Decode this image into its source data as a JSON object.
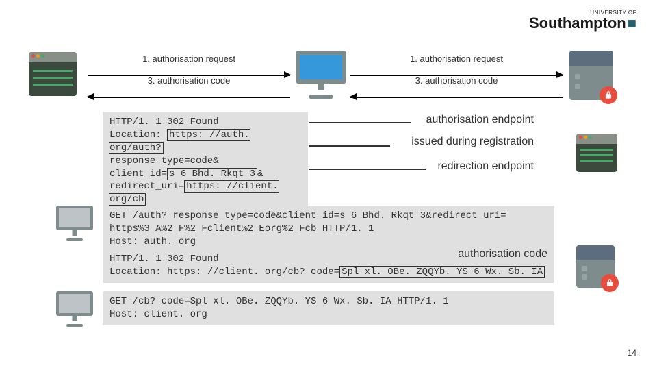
{
  "logo": {
    "top": "UNIVERSITY OF",
    "main": "Southampton"
  },
  "arrows": {
    "step1_left": "1. authorisation request",
    "step1_right": "1. authorisation request",
    "step3_left": "3. authorisation code",
    "step3_right": "3. authorisation code"
  },
  "http": {
    "box1": {
      "line1_pre": "HTTP/1. 1 ",
      "line1_hl": "302 Found",
      "line2_pre": "Location: ",
      "line2_hl": "https: //auth. org/auth?",
      "line3": "  response_type=code&",
      "line4_pre": "  client_id=",
      "line4_hl": "s 6 Bhd. Rkqt 3",
      "line4_post": "&",
      "line5_pre": "  redirect_uri=",
      "line5_hl": "https: //client. org/cb"
    },
    "box2": {
      "line1": "GET /auth? response_type=code&client_id=s 6 Bhd. Rkqt 3&redirect_uri=",
      "line2": "    https%3 A%2 F%2 Fclient%2 Eorg%2 Fcb HTTP/1. 1",
      "line3": "Host: auth. org"
    },
    "box3": {
      "line1": "HTTP/1. 1 302 Found",
      "line2_pre": "Location: https: //client. org/cb? code=",
      "line2_hl": "Spl xl. OBe. ZQQYb. YS 6 Wx. Sb. IA"
    },
    "box4": {
      "line1": "GET /cb? code=Spl xl. OBe. ZQQYb. YS 6 Wx. Sb. IA HTTP/1. 1",
      "line2": "Host: client. org"
    }
  },
  "annotations": {
    "a1": "authorisation endpoint",
    "a2": "issued during registration",
    "a3": "redirection endpoint",
    "a4": "authorisation code"
  },
  "page": "14"
}
